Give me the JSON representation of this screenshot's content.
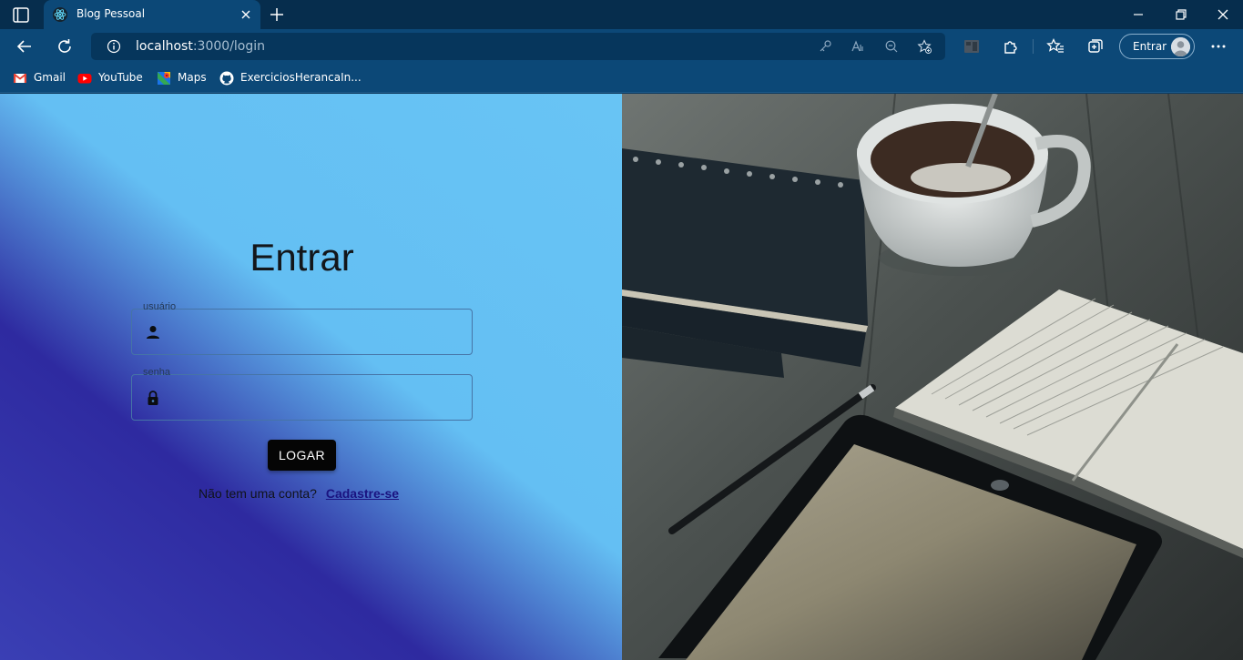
{
  "browser": {
    "tab_title": "Blog Pessoal",
    "url_host": "localhost",
    "url_path": ":3000/login",
    "profile_label": "Entrar"
  },
  "bookmarks": [
    {
      "label": "Gmail",
      "icon": "gmail-icon"
    },
    {
      "label": "YouTube",
      "icon": "youtube-icon"
    },
    {
      "label": "Maps",
      "icon": "maps-icon"
    },
    {
      "label": "ExerciciosHerancaIn...",
      "icon": "github-icon"
    }
  ],
  "login": {
    "title": "Entrar",
    "username_label": "usuário",
    "username_value": "",
    "password_label": "senha",
    "password_value": "",
    "submit_label": "LOGAR",
    "signup_prompt": "Não tem uma conta?",
    "signup_link": "Cadastre-se"
  },
  "colors": {
    "browser_frame": "#0c4877",
    "tabstrip": "#062d4d",
    "gradient_dark": "#2e2aa0",
    "gradient_light": "#68c4f4",
    "button": "#050505",
    "link": "#1a1380"
  },
  "image": {
    "subject": "notebooks-coffee-tablet-photo"
  }
}
